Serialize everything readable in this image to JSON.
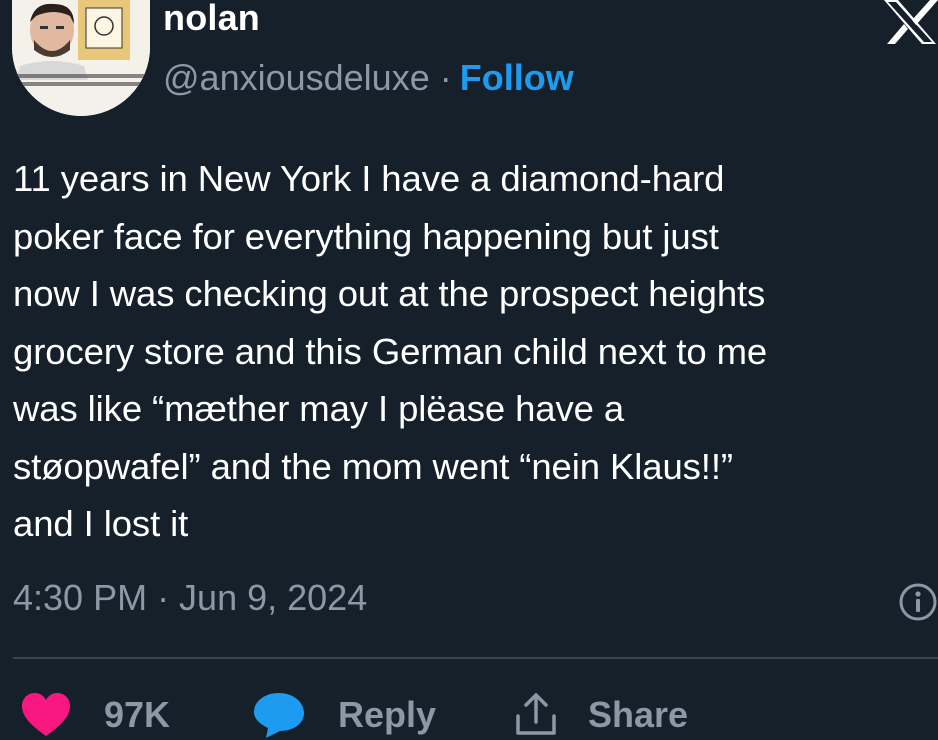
{
  "author": {
    "display_name": "nolan",
    "handle": "@anxiousdeluxe",
    "separator": "·",
    "follow_label": "Follow"
  },
  "tweet": {
    "text": "11 years in New York I have a diamond-hard\npoker face for everything happening but just\nnow I was checking out at the prospect heights\ngrocery store and this German child next to me\nwas like “mæther may I plëase have a\nstøopwafel” and the mom went “nein Klaus!!”\nand I lost it",
    "timestamp": "4:30 PM · Jun 9, 2024"
  },
  "actions": {
    "likes_count": "97K",
    "reply_label": "Reply",
    "share_label": "Share"
  },
  "icons": {
    "logo": "x-logo-icon",
    "info": "info-icon",
    "like": "heart-icon",
    "reply": "speech-bubble-icon",
    "share": "share-icon"
  },
  "colors": {
    "background": "#15202b",
    "text": "#ffffff",
    "secondary_text": "#8b98a5",
    "accent": "#1d9bf0",
    "heart": "#f91880",
    "divider": "#38444d"
  }
}
